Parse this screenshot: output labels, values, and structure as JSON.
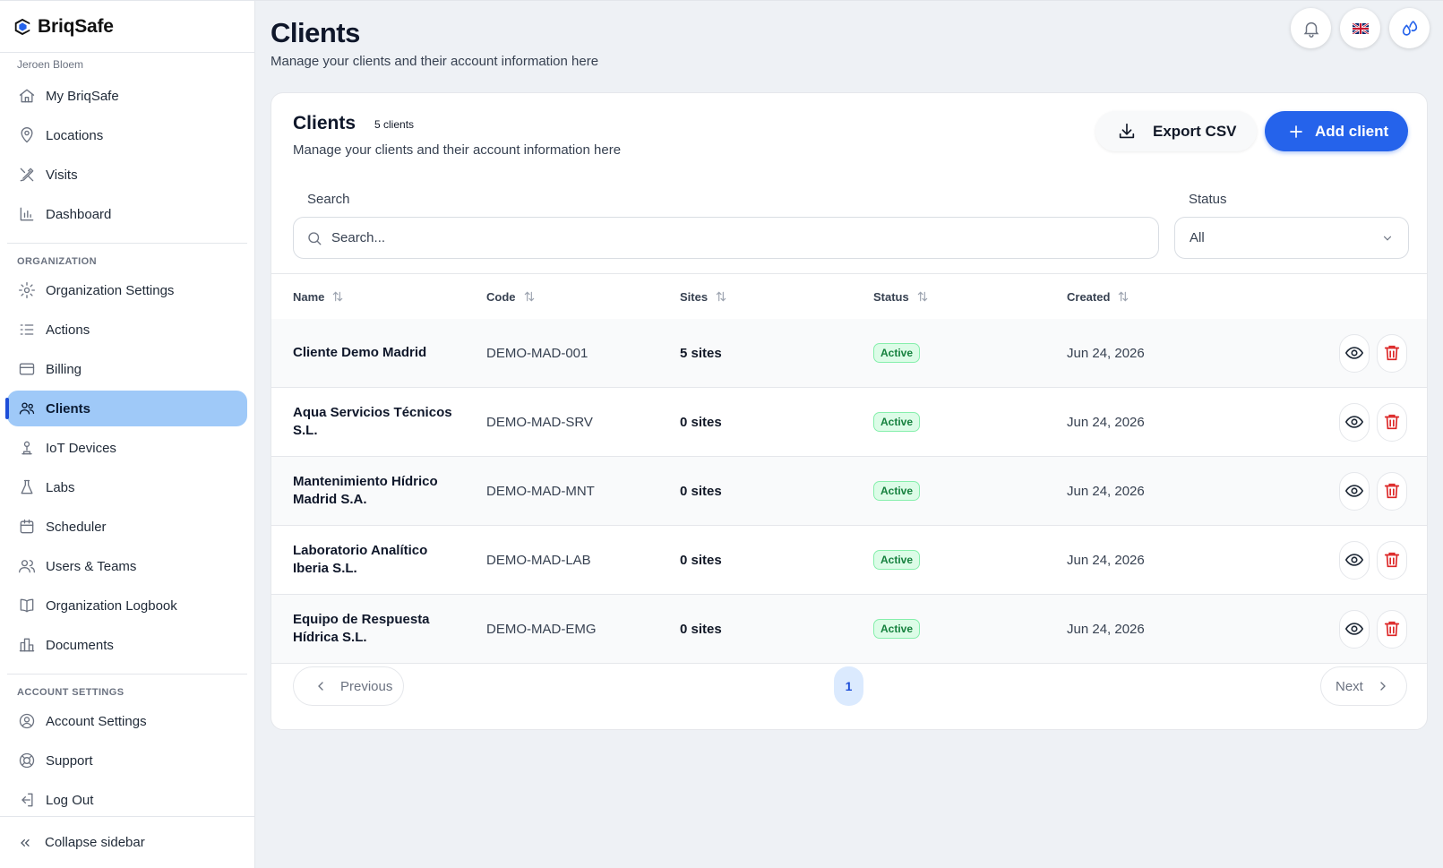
{
  "brand": {
    "name": "BriqSafe"
  },
  "user": {
    "name": "Jeroen Bloem"
  },
  "sidebar": {
    "main_items": [
      {
        "label": "My BriqSafe",
        "icon": "home-icon"
      },
      {
        "label": "Locations",
        "icon": "location-pin-icon"
      },
      {
        "label": "Visits",
        "icon": "tools-icon"
      },
      {
        "label": "Dashboard",
        "icon": "bar-chart-icon"
      }
    ],
    "org_section_label": "ORGANIZATION",
    "org_items": [
      {
        "label": "Organization Settings",
        "icon": "gear-icon"
      },
      {
        "label": "Actions",
        "icon": "checklist-icon"
      },
      {
        "label": "Billing",
        "icon": "credit-card-icon"
      },
      {
        "label": "Clients",
        "icon": "clients-icon",
        "active": true
      },
      {
        "label": "IoT Devices",
        "icon": "device-icon"
      },
      {
        "label": "Labs",
        "icon": "flask-icon"
      },
      {
        "label": "Scheduler",
        "icon": "calendar-icon"
      },
      {
        "label": "Users & Teams",
        "icon": "users-icon"
      },
      {
        "label": "Organization Logbook",
        "icon": "book-icon"
      },
      {
        "label": "Documents",
        "icon": "documents-icon"
      }
    ],
    "account_section_label": "ACCOUNT SETTINGS",
    "account_items": [
      {
        "label": "Account Settings",
        "icon": "user-circle-icon"
      },
      {
        "label": "Support",
        "icon": "lifebuoy-icon"
      },
      {
        "label": "Log Out",
        "icon": "logout-icon"
      }
    ],
    "collapse_label": "Collapse sidebar"
  },
  "header": {
    "title": "Clients",
    "subtitle": "Manage your clients and their account information here"
  },
  "card": {
    "title": "Clients",
    "count": "5 clients",
    "subtitle": "Manage your clients and their account information here",
    "export_label": "Export CSV",
    "add_label": "Add client",
    "search_label": "Search",
    "search_placeholder": "Search...",
    "status_label": "Status",
    "status_value": "All"
  },
  "table": {
    "columns": {
      "name": "Name",
      "code": "Code",
      "sites": "Sites",
      "status": "Status",
      "created": "Created"
    },
    "rows": [
      {
        "name": "Cliente Demo Madrid",
        "code": "DEMO-MAD-001",
        "sites": "5 sites",
        "status": "Active",
        "created": "Jun 24, 2026"
      },
      {
        "name": "Aqua Servicios Técnicos S.L.",
        "code": "DEMO-MAD-SRV",
        "sites": "0 sites",
        "status": "Active",
        "created": "Jun 24, 2026"
      },
      {
        "name": "Mantenimiento Hídrico Madrid S.A.",
        "code": "DEMO-MAD-MNT",
        "sites": "0 sites",
        "status": "Active",
        "created": "Jun 24, 2026"
      },
      {
        "name": "Laboratorio Analítico Iberia S.L.",
        "code": "DEMO-MAD-LAB",
        "sites": "0 sites",
        "status": "Active",
        "created": "Jun 24, 2026"
      },
      {
        "name": "Equipo de Respuesta Hídrica S.L.",
        "code": "DEMO-MAD-EMG",
        "sites": "0 sites",
        "status": "Active",
        "created": "Jun 24, 2026"
      }
    ]
  },
  "pagination": {
    "previous": "Previous",
    "page": "1",
    "next": "Next"
  },
  "colors": {
    "accent": "#2563eb",
    "active_nav": "#9fc9f8",
    "badge_bg": "#dcfce7",
    "badge_text": "#15803d",
    "delete": "#dc2626"
  }
}
